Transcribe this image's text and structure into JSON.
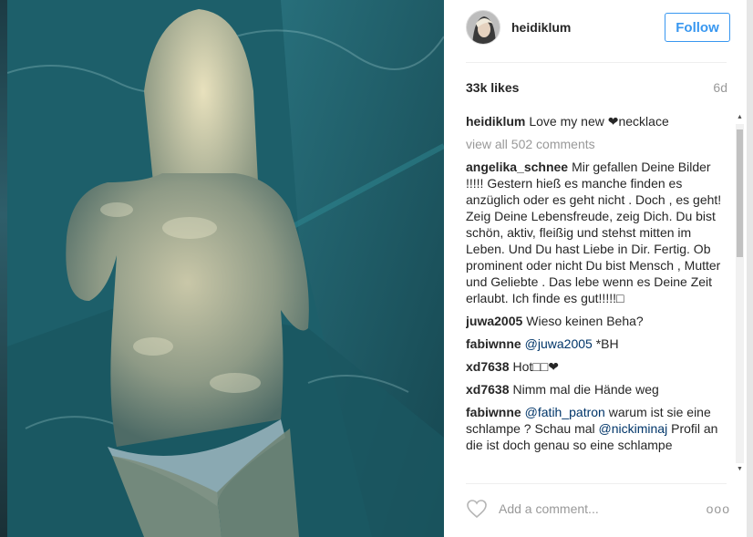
{
  "post": {
    "photo_icon": "underwater-photo",
    "username": "heidiklum",
    "follow_label": "Follow",
    "likes": "33k likes",
    "age": "6d",
    "caption": {
      "user": "heidiklum",
      "text_before": "Love my new ",
      "heart_glyph": "❤",
      "text_after": "necklace"
    },
    "view_all": "view all 502 comments",
    "comments": [
      {
        "user": "angelika_schnee",
        "text": "Mir gefallen Deine Bilder !!!!! Gestern hieß es manche finden es anzüglich oder es geht nicht . Doch , es geht! Zeig Deine Lebensfreude, zeig Dich. Du bist schön, aktiv, fleißig und stehst mitten im Leben. Und Du hast Liebe in Dir. Fertig. Ob prominent oder nicht Du bist Mensch , Mutter und Geliebte . Das lebe wenn es Deine Zeit erlaubt. Ich finde es gut!!!!!"
      },
      {
        "user": "juwa2005",
        "text": "Wieso keinen Beha?"
      },
      {
        "user": "fabiwnne",
        "mention": "@juwa2005",
        "text": " *BH"
      },
      {
        "user": "xd7638",
        "text": "Hot",
        "heart": "❤"
      },
      {
        "user": "xd7638",
        "text": "Nimm mal die Hände weg"
      },
      {
        "user": "fabiwnne",
        "mention": "@fatih_patron",
        "text": " warum ist sie eine schlampe ? Schau mal ",
        "mention2": "@nickiminaj",
        "text2": " Profil an die ist doch genau so eine schlampe"
      }
    ],
    "add_comment_placeholder": "Add a comment...",
    "more_label": "ooo"
  }
}
